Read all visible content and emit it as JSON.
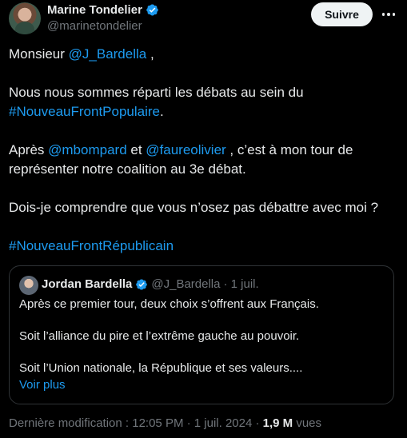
{
  "author": {
    "name": "Marine Tondelier",
    "handle": "@marinetondelier"
  },
  "follow_label": "Suivre",
  "tweet": {
    "line1_prefix": "Monsieur ",
    "mention_bardella": "@J_Bardella",
    "line1_suffix": " ,",
    "line2": "Nous nous sommes réparti les débats au sein du",
    "hashtag_nfp": "#NouveauFrontPopulaire",
    "hashtag_nfp_suffix": ".",
    "line3_prefix": "Après ",
    "mention_bompard": "@mbompard",
    "line3_mid": " et ",
    "mention_faure": "@faureolivier",
    "line3_suffix": " , c’est à mon tour de",
    "line4": "représenter notre coalition au 3e débat.",
    "line5": "Dois-je comprendre que vous n’osez pas débattre avec moi ?",
    "hashtag_nfr": "#NouveauFrontRépublicain"
  },
  "quote": {
    "name": "Jordan Bardella",
    "handle": "@J_Bardella",
    "date": "· 1 juil.",
    "line1": "Après ce premier tour, deux choix s’offrent aux Français.",
    "line2": "Soit l’alliance du pire et l’extrême gauche au pouvoir.",
    "line3": "Soit l’Union nationale, la République et ses valeurs....",
    "more_label": "Voir plus"
  },
  "footer": {
    "edited": "Dernière modification : 12:05 PM · 1 juil. 2024 · ",
    "views_count": "1,9 M",
    "views_label": " vues"
  },
  "colors": {
    "background": "#000000",
    "link": "#1d9bf0",
    "verified": "#1d9bf0",
    "muted": "#71767b"
  },
  "icons": [
    "verified-badge-icon",
    "more-options-icon"
  ]
}
